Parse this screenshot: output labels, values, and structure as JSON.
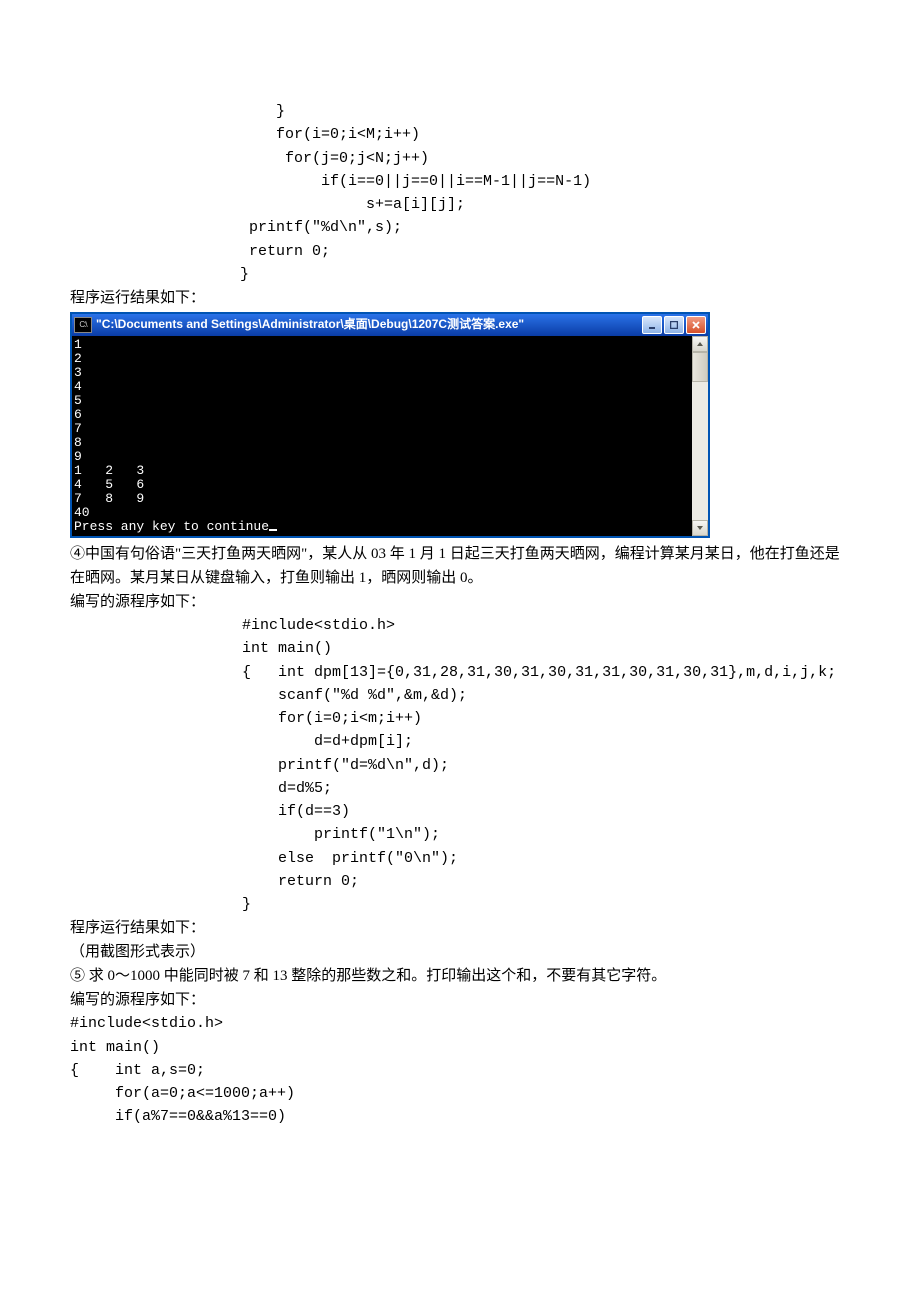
{
  "code_top": "              }\n              for(i=0;i<M;i++)\n               for(j=0;j<N;j++)\n                   if(i==0||j==0||i==M-1||j==N-1)\n                        s+=a[i][j];\n           printf(\"%d\\n\",s);\n           return 0;\n          }",
  "result_label": "程序运行结果如下：",
  "console": {
    "title": "\"C:\\Documents and Settings\\Administrator\\桌面\\Debug\\1207C测试答案.exe\"",
    "icon_text": "C:\\",
    "output": "1\n2\n3\n4\n5\n6\n7\n8\n9\n1   2   3\n4   5   6\n7   8   9\n40\nPress any key to continue"
  },
  "problem4": " ④中国有句俗语\"三天打鱼两天晒网\"，某人从 03 年 1 月 1 日起三天打鱼两天晒网，编程计算某月某日，他在打鱼还是在晒网。某月某日从键盘输入，打鱼则输出 1，晒网则输出 0。",
  "src_label": "编写的源程序如下：",
  "code4": "        #include<stdio.h>\n        int main()\n        {   int dpm[13]={0,31,28,31,30,31,30,31,31,30,31,30,31},m,d,i,j,k;\n            scanf(\"%d %d\",&m,&d);\n            for(i=0;i<m;i++)\n                d=d+dpm[i];\n            printf(\"d=%d\\n\",d);\n            d=d%5;\n            if(d==3)\n                printf(\"1\\n\");\n            else  printf(\"0\\n\");\n            return 0;\n        }",
  "result4_label": "程序运行结果如下：",
  "result4_note": "  （用截图形式表示）",
  "problem5": " ⑤ 求 0～1000 中能同时被 7 和 13 整除的那些数之和。打印输出这个和，不要有其它字符。",
  "src_label5": "编写的源程序如下：",
  "code5": "#include<stdio.h>\nint main()\n{    int a,s=0;\n     for(a=0;a<=1000;a++)\n     if(a%7==0&&a%13==0)"
}
